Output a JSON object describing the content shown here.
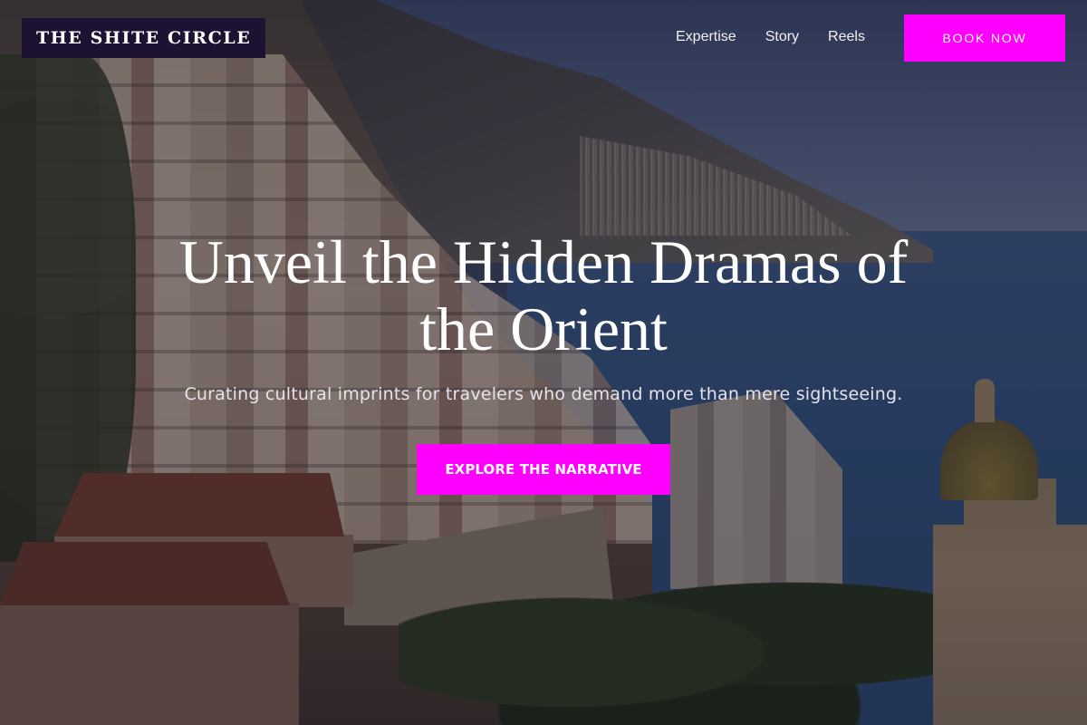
{
  "brand": {
    "name": "THE SHITE CIRCLE"
  },
  "nav": {
    "items": [
      {
        "label": "Expertise"
      },
      {
        "label": "Story"
      },
      {
        "label": "Reels"
      }
    ],
    "cta_label": "BOOK NOW"
  },
  "hero": {
    "title_line1": "Unveil the Hidden Dramas of",
    "title_line2": "the Orient",
    "subtitle": "Curating cultural imprints for travelers who demand more than mere sightseeing.",
    "cta_label": "EXPLORE THE NARRATIVE"
  },
  "colors": {
    "accent": "#ff00ff",
    "logo_bg": "#1e1232",
    "text": "#ffffff"
  }
}
